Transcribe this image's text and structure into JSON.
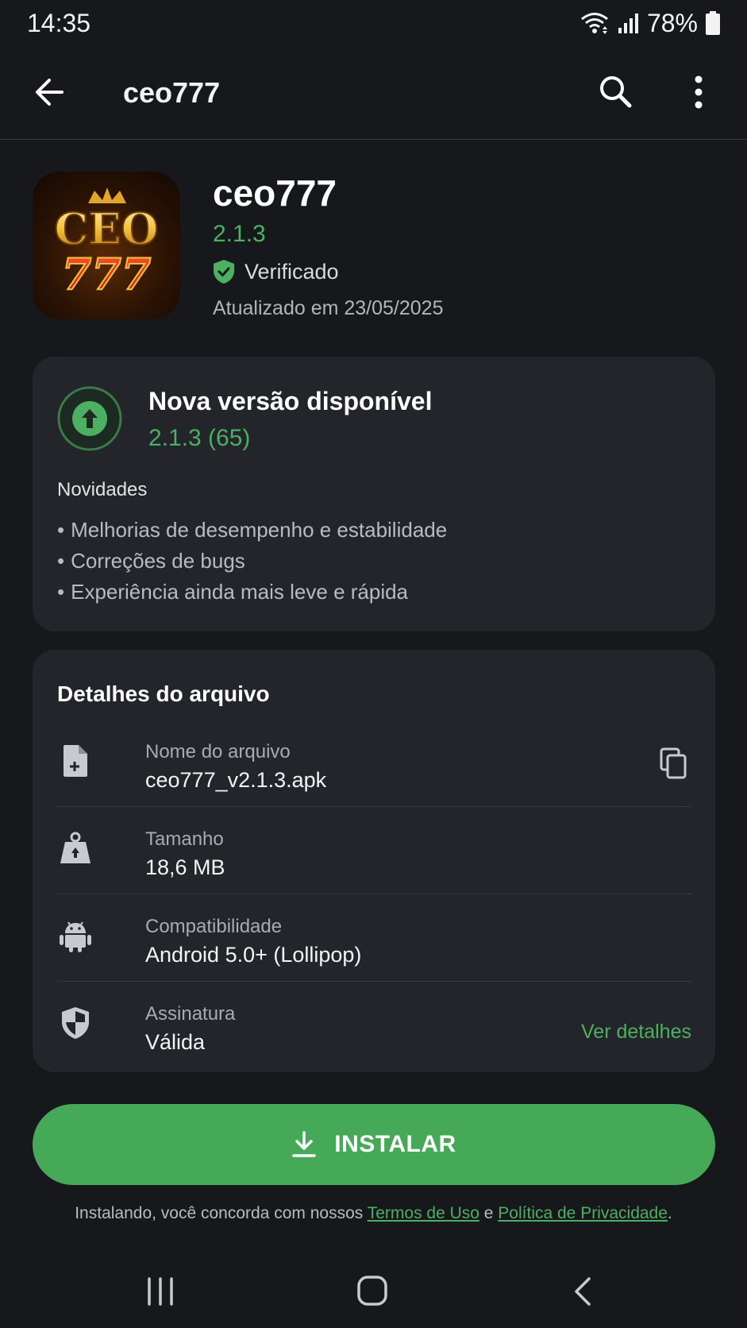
{
  "status_bar": {
    "time": "14:35",
    "battery_percent": "78%",
    "icons": [
      "wifi-icon",
      "signal-icon",
      "battery-icon"
    ]
  },
  "app_bar": {
    "title": "ceo777",
    "icons": [
      "back-arrow-icon",
      "search-icon",
      "more-vert-icon"
    ]
  },
  "app": {
    "name": "ceo777",
    "version": "2.1.3",
    "verified_label": "Verificado",
    "updated": "Atualizado em 23/05/2025",
    "icon_logo_text_top": "CEO",
    "icon_logo_text_bottom": "777"
  },
  "update_card": {
    "title": "Nova versão disponível",
    "version": "2.1.3 (65)",
    "news_label": "Novidades",
    "bullet": "•",
    "news": [
      "Melhorias de desempenho e estabilidade",
      "Correções de bugs",
      "Experiência ainda mais leve e rápida"
    ]
  },
  "file_details": {
    "title": "Detalhes do arquivo",
    "rows": [
      {
        "icon": "file-icon",
        "label": "Nome do arquivo",
        "value": "ceo777_v2.1.3.apk",
        "action_icon": "copy-icon"
      },
      {
        "icon": "weight-icon",
        "label": "Tamanho",
        "value": "18,6 MB"
      },
      {
        "icon": "android-icon",
        "label": "Compatibilidade",
        "value": "Android 5.0+ (Lollipop)"
      },
      {
        "icon": "shield-icon",
        "label": "Assinatura",
        "value": "Válida",
        "action_label": "Ver detalhes"
      }
    ]
  },
  "install": {
    "label": "INSTALAR",
    "icon": "download-icon"
  },
  "terms": {
    "prefix": "Instalando, você concorda com nossos ",
    "terms_link": "Termos de Uso",
    "conjunction": " e ",
    "privacy_link": "Política de Privacidade",
    "suffix": "."
  },
  "colors": {
    "background": "#17181b",
    "card": "#24252a",
    "accent_green": "#4caf61",
    "button_green": "#46a957"
  }
}
